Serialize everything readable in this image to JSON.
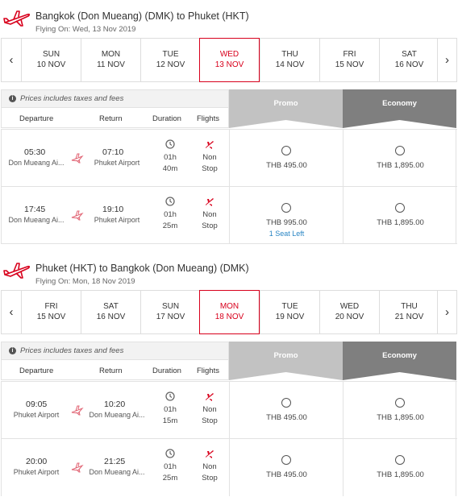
{
  "icons": {
    "plane": "airplane-icon",
    "info": "info-icon",
    "clock": "clock-icon",
    "prev": "chevron-left-icon",
    "next": "chevron-right-icon"
  },
  "colors": {
    "accent": "#d8001c",
    "link": "#2a86c4",
    "promo_band": "#c2c2c2",
    "economy_band": "#7f7f7f"
  },
  "outbound": {
    "title": "Bangkok (Don Mueang) (DMK) to Phuket (HKT)",
    "flying_on": "Flying On: Wed, 13 Nov 2019",
    "prev_arrow": "‹",
    "next_arrow": "›",
    "days": [
      {
        "dow": "SUN",
        "date": "10 NOV"
      },
      {
        "dow": "MON",
        "date": "11 NOV"
      },
      {
        "dow": "TUE",
        "date": "12 NOV"
      },
      {
        "dow": "WED",
        "date": "13 NOV"
      },
      {
        "dow": "THU",
        "date": "14 NOV"
      },
      {
        "dow": "FRI",
        "date": "15 NOV"
      },
      {
        "dow": "SAT",
        "date": "16 NOV"
      }
    ],
    "active_index": 3,
    "info": "Prices includes taxes and fees",
    "headers": {
      "departure": "Departure",
      "return": "Return",
      "duration": "Duration",
      "flights": "Flights"
    },
    "fare_classes": {
      "promo": "Promo",
      "economy": "Economy"
    },
    "flights": [
      {
        "dep_time": "05:30",
        "dep_airport": "Don Mueang Ai...",
        "arr_time": "07:10",
        "arr_airport": "Phuket Airport",
        "dur_h": "01h",
        "dur_m": "40m",
        "stop1": "Non",
        "stop2": "Stop",
        "promo_price": "THB 495.00",
        "promo_seats": "",
        "economy_price": "THB 1,895.00"
      },
      {
        "dep_time": "17:45",
        "dep_airport": "Don Mueang Ai...",
        "arr_time": "19:10",
        "arr_airport": "Phuket Airport",
        "dur_h": "01h",
        "dur_m": "25m",
        "stop1": "Non",
        "stop2": "Stop",
        "promo_price": "THB 995.00",
        "promo_seats": "1 Seat Left",
        "economy_price": "THB 1,895.00"
      }
    ]
  },
  "return": {
    "title": "Phuket (HKT) to Bangkok (Don Mueang) (DMK)",
    "flying_on": "Flying On: Mon, 18 Nov 2019",
    "prev_arrow": "‹",
    "next_arrow": "›",
    "days": [
      {
        "dow": "FRI",
        "date": "15 NOV"
      },
      {
        "dow": "SAT",
        "date": "16 NOV"
      },
      {
        "dow": "SUN",
        "date": "17 NOV"
      },
      {
        "dow": "MON",
        "date": "18 NOV"
      },
      {
        "dow": "TUE",
        "date": "19 NOV"
      },
      {
        "dow": "WED",
        "date": "20 NOV"
      },
      {
        "dow": "THU",
        "date": "21 NOV"
      }
    ],
    "active_index": 3,
    "info": "Prices includes taxes and fees",
    "headers": {
      "departure": "Departure",
      "return": "Return",
      "duration": "Duration",
      "flights": "Flights"
    },
    "fare_classes": {
      "promo": "Promo",
      "economy": "Economy"
    },
    "flights": [
      {
        "dep_time": "09:05",
        "dep_airport": "Phuket Airport",
        "arr_time": "10:20",
        "arr_airport": "Don Mueang Ai...",
        "dur_h": "01h",
        "dur_m": "15m",
        "stop1": "Non",
        "stop2": "Stop",
        "promo_price": "THB 495.00",
        "promo_seats": "",
        "economy_price": "THB 1,895.00"
      },
      {
        "dep_time": "20:00",
        "dep_airport": "Phuket Airport",
        "arr_time": "21:25",
        "arr_airport": "Don Mueang Ai...",
        "dur_h": "01h",
        "dur_m": "25m",
        "stop1": "Non",
        "stop2": "Stop",
        "promo_price": "THB 495.00",
        "promo_seats": "",
        "economy_price": "THB 1,895.00"
      }
    ]
  }
}
